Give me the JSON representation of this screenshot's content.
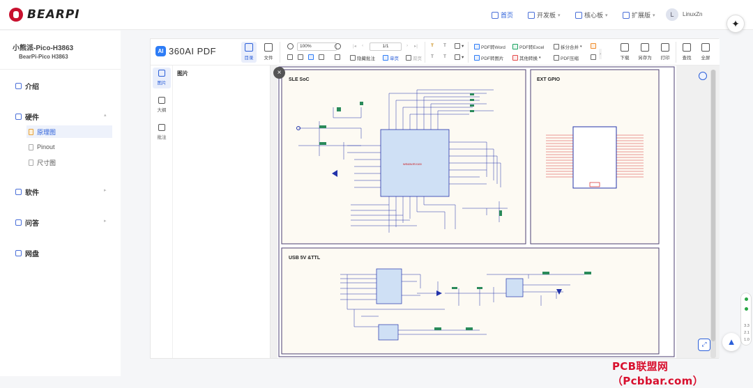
{
  "site": {
    "logo_text": "BEARPI",
    "nav": [
      {
        "label": "首页",
        "icon": "home-icon"
      },
      {
        "label": "开发板",
        "icon": "board-icon"
      },
      {
        "label": "核心板",
        "icon": "core-icon"
      },
      {
        "label": "扩展版",
        "icon": "extension-icon"
      }
    ],
    "user": {
      "initial": "L",
      "name": "LinuxZn"
    }
  },
  "sidebar": {
    "title": "小熊派-Pico-H3863",
    "subtitle": "BearPi-Pico H3863",
    "sections": [
      {
        "label": "介绍",
        "icon": "doc-icon"
      },
      {
        "label": "硬件",
        "icon": "chip-icon",
        "children": [
          "原理图",
          "Pinout",
          "尺寸图"
        ],
        "active_child": "原理图"
      },
      {
        "label": "软件",
        "icon": "code-icon"
      },
      {
        "label": "问答",
        "icon": "chat-icon"
      },
      {
        "label": "网盘",
        "icon": "download-icon"
      }
    ]
  },
  "viewer": {
    "app_name": "360AI PDF",
    "ai_badge": "AI",
    "tools_main": [
      {
        "label": "目录",
        "icon": "toc-icon"
      },
      {
        "label": "文件",
        "icon": "folder-icon"
      }
    ],
    "zoom": "100%",
    "page": "1/1",
    "tools_small": [
      "隐藏批注",
      "单页",
      "双页"
    ],
    "convert": [
      "PDF转Word",
      "PDF转Excel",
      "PDF转图片",
      "其他转换",
      "拆分合并",
      "PDF压缩"
    ],
    "right_tools": [
      "下载",
      "另存为",
      "打印",
      "查找",
      "全屏"
    ],
    "rail": [
      "图片",
      "大纲",
      "批注"
    ],
    "panel_title": "图片",
    "close_label": "×"
  },
  "schematic": {
    "block1": "SLE SoC",
    "block2": "EXT GPIO",
    "block3": "USB 5V &TTL",
    "chip_label": "WS63V/EV100"
  },
  "float": {
    "s1": "3.3",
    "s2": "2.1",
    "s3": "1.0"
  },
  "watermark": "PCB联盟网（Pcbbar.com）",
  "colors": {
    "accent": "#2b5fd9",
    "brand_red": "#c8102e",
    "schematic_line": "#2233aa",
    "schematic_border": "#4b3f72"
  }
}
